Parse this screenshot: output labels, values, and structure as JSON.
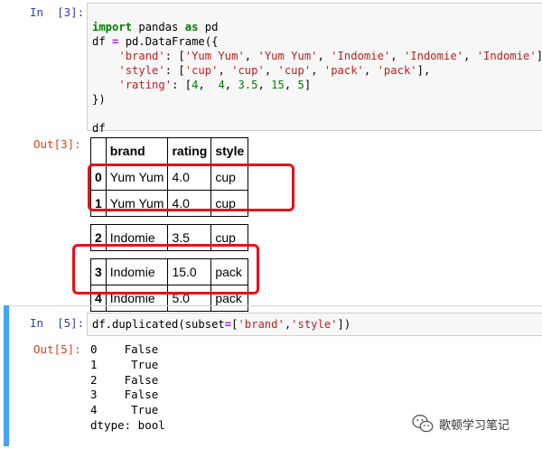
{
  "cell3": {
    "in_prompt": "In  [3]:",
    "out_prompt": "Out[3]:",
    "code": {
      "l1_kw1": "import",
      "l1_mod": " pandas ",
      "l1_kw2": "as",
      "l1_alias": " pd",
      "l2_pre": "df ",
      "l2_eq": "=",
      "l2_post": " pd.DataFrame({",
      "l3_key": "'brand'",
      "l3_colon": ": [",
      "l3_v1": "'Yum Yum'",
      "l3_v2": "'Yum Yum'",
      "l3_v3": "'Indomie'",
      "l3_v4": "'Indomie'",
      "l3_v5": "'Indomie'",
      "l3_end": "],",
      "l4_key": "'style'",
      "l4_colon": ": [",
      "l4_v1": "'cup'",
      "l4_v2": "'cup'",
      "l4_v3": "'cup'",
      "l4_v4": "'pack'",
      "l4_v5": "'pack'",
      "l4_end": "],",
      "l5_key": "'rating'",
      "l5_colon": ": [",
      "l5_v1": "4",
      "l5_v2": "4",
      "l5_v3": "3.5",
      "l5_v4": "15",
      "l5_v5": "5",
      "l5_end": "]",
      "l6": "})",
      "l8": "df"
    },
    "table": {
      "headers": [
        "",
        "brand",
        "rating",
        "style"
      ],
      "rows": [
        {
          "index": "0",
          "brand": "Yum Yum",
          "rating": "4.0",
          "style": "cup"
        },
        {
          "index": "1",
          "brand": "Yum Yum",
          "rating": "4.0",
          "style": "cup"
        },
        {
          "index": "2",
          "brand": "Indomie",
          "rating": "3.5",
          "style": "cup"
        },
        {
          "index": "3",
          "brand": "Indomie",
          "rating": "15.0",
          "style": "pack"
        },
        {
          "index": "4",
          "brand": "Indomie",
          "rating": "5.0",
          "style": "pack"
        }
      ]
    },
    "highlight_color": "#e8101a"
  },
  "cell5": {
    "in_prompt": "In  [5]:",
    "out_prompt": "Out[5]:",
    "code": {
      "pre": "df.duplicated(subset",
      "eq": "=",
      "bracket": "[",
      "s1": "'brand'",
      "comma": ",",
      "s2": "'style'",
      "end": "])"
    },
    "output_lines": [
      "0    False",
      "1     True",
      "2    False",
      "3    False",
      "4     True",
      "dtype: bool"
    ],
    "selected_bar_color": "#42a5f5"
  },
  "watermark": {
    "icon": "wechat-icon",
    "text": "歌顿学习笔记"
  }
}
